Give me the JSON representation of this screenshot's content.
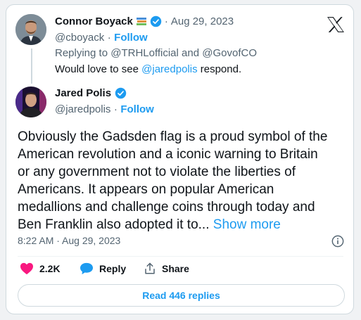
{
  "reply_tweet": {
    "author_name": "Connor Boyack",
    "handle": "@cboyack",
    "separator": "·",
    "date": "Aug 29, 2023",
    "follow_label": "Follow",
    "replying_prefix": "Replying to",
    "replying_users": [
      "@TRHLofficial",
      "@GovofCO"
    ],
    "replying_joiner": "and",
    "text_before": "Would love to see",
    "mention": "@jaredpolis",
    "text_after": "respond."
  },
  "main_tweet": {
    "author_name": "Jared Polis",
    "handle": "@jaredpolis",
    "separator": "·",
    "follow_label": "Follow",
    "lines": [
      "Obviously the Gadsden flag is a proud symbol of the",
      "American revolution and a iconic warning to Britain",
      "or any government not to violate the liberties of",
      "Americans. It appears on popular American",
      "medallions and challenge coins through today and",
      "Ben Franklin also adopted it to..."
    ],
    "show_more": "Show more",
    "timestamp": "8:22 AM · Aug 29, 2023"
  },
  "actions": {
    "likes": "2.2K",
    "reply_label": "Reply",
    "share_label": "Share"
  },
  "read_replies_label": "Read 446 replies",
  "colors": {
    "accent": "#1d9bf0",
    "like": "#f91880",
    "text": "#0f1419",
    "muted": "#536471"
  },
  "icons": [
    "x-logo-icon",
    "verified-badge-icon",
    "books-emoji-icon",
    "heart-icon",
    "reply-bubble-icon",
    "share-icon",
    "info-icon"
  ]
}
